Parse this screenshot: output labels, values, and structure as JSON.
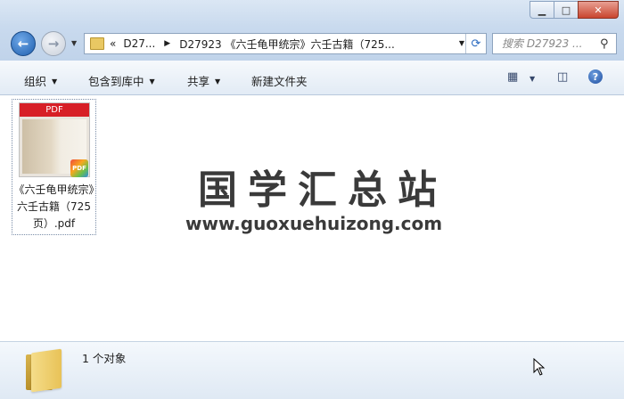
{
  "window": {
    "minimize_icon": "minimize-icon",
    "maximize_icon": "maximize-icon",
    "close_icon": "close-icon",
    "minimize_glyph": "▁",
    "maximize_glyph": "□",
    "close_glyph": "✕"
  },
  "nav": {
    "back_glyph": "←",
    "forward_glyph": "→",
    "dropdown_glyph": "▼",
    "refresh_glyph": "⟳"
  },
  "address": {
    "overflow": "«",
    "crumbs": [
      "D27...",
      "D27923 《六壬龟甲统宗》六壬古籍（725..."
    ],
    "separator": "▶"
  },
  "search": {
    "placeholder": "搜索 D27923 ...",
    "icon": "search-icon",
    "glyph": "⚲"
  },
  "toolbar": {
    "organize": "组织",
    "include_library": "包含到库中",
    "share": "共享",
    "new_folder": "新建文件夹",
    "caret": "▼",
    "views_glyph": "▦",
    "pane_glyph": "◫",
    "help_glyph": "?"
  },
  "file": {
    "name": "《六壬龟甲统宗》六壬古籍（725页）.pdf",
    "banner": "PDF",
    "badge": "PDF"
  },
  "watermark": {
    "title": "国学汇总站",
    "url": "www.guoxuehuizong.com"
  },
  "status": {
    "count": "1 个对象"
  },
  "colors": {
    "pdf_red": "#d71f26",
    "folder_yellow": "#e8c257",
    "accent_blue": "#1f5fae"
  }
}
